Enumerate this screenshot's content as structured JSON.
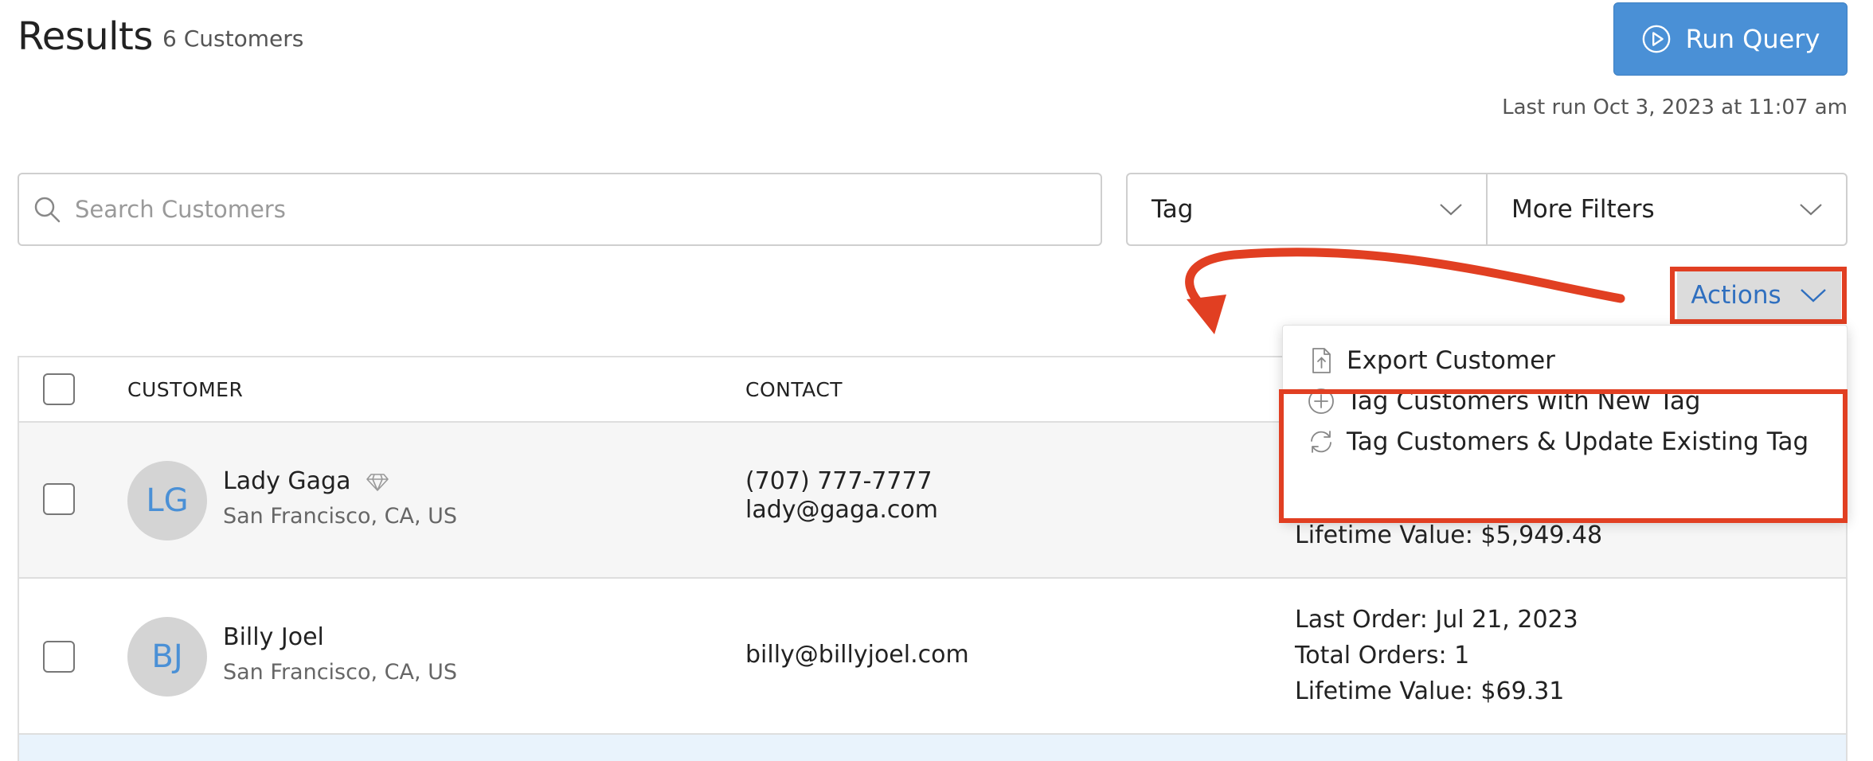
{
  "header": {
    "title": "Results",
    "count": "6 Customers",
    "run_button_label": "Run Query",
    "last_run": "Last run Oct 3, 2023 at 11:07 am"
  },
  "filters": {
    "search_placeholder": "Search Customers",
    "tag_label": "Tag",
    "more_filters_label": "More Filters"
  },
  "actions": {
    "button_label": "Actions",
    "menu_items": [
      {
        "label": "Export Customer",
        "icon": "export-file-icon"
      },
      {
        "label": "Tag Customers with New Tag",
        "icon": "plus-circle-icon"
      },
      {
        "label": "Tag Customers & Update Existing Tag",
        "icon": "refresh-icon"
      }
    ]
  },
  "table": {
    "columns": [
      "CUSTOMER",
      "CONTACT"
    ],
    "rows": [
      {
        "initials": "LG",
        "name": "Lady Gaga",
        "location": "San Francisco, CA, US",
        "phone": "(707) 777-7777",
        "email": "lady@gaga.com",
        "lifetime_value": "Lifetime Value: $5,949.48"
      },
      {
        "initials": "BJ",
        "name": "Billy Joel",
        "location": "San Francisco, CA, US",
        "email": "billy@billyjoel.com",
        "last_order": "Last Order: Jul 21, 2023",
        "total_orders": "Total Orders: 1",
        "lifetime_value": "Lifetime Value: $69.31"
      }
    ]
  },
  "colors": {
    "accent": "#4a90d6",
    "highlight": "#e13f22",
    "row_selected": "#f6f6f6"
  }
}
